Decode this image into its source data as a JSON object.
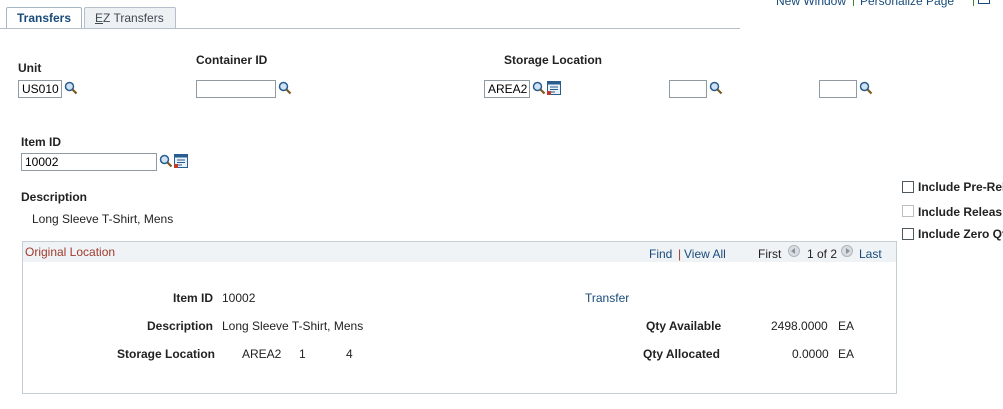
{
  "tabs": [
    {
      "label": "Transfers",
      "active": true
    },
    {
      "label": "EZ Transfers",
      "accesskey": "E",
      "rest": "Z Transfers",
      "active": false
    }
  ],
  "top_links": {
    "new_window": "New Window",
    "personalize": "Personalize Page"
  },
  "header": {
    "unit_label": "Unit",
    "unit_value": "US010",
    "container_label": "Container ID",
    "container_value": "",
    "storage_label": "Storage Location",
    "storage_area_value": "AREA2",
    "storage_level2_value": "",
    "storage_level3_value": ""
  },
  "item": {
    "item_id_label": "Item ID",
    "item_id_value": "10002",
    "description_label": "Description",
    "description_value": "Long Sleeve T-Shirt, Mens"
  },
  "options": [
    {
      "label": "Include Pre-Rel",
      "checked": false,
      "enabled": true
    },
    {
      "label": "Include Releas",
      "checked": false,
      "enabled": false
    },
    {
      "label": "Include Zero Qt",
      "checked": false,
      "enabled": true
    }
  ],
  "grid": {
    "title": "Original Location",
    "find": "Find",
    "separator": "|",
    "view_all": "View All",
    "first": "First",
    "range": "1 of 2",
    "last": "Last",
    "row": {
      "item_id_label": "Item ID",
      "item_id_value": "10002",
      "description_label": "Description",
      "description_value": "Long Sleeve T-Shirt, Mens",
      "storage_label": "Storage Location",
      "storage_area": "AREA2",
      "storage_level2": "1",
      "storage_level3": "4",
      "transfer_link": "Transfer",
      "qty_available_label": "Qty Available",
      "qty_available_value": "2498.0000",
      "qty_available_uom": "EA",
      "qty_allocated_label": "Qty Allocated",
      "qty_allocated_value": "0.0000",
      "qty_allocated_uom": "EA"
    }
  },
  "colors": {
    "link": "#184b7a",
    "grid_title": "#a13b2c",
    "tab_border": "#b4bfcb"
  }
}
